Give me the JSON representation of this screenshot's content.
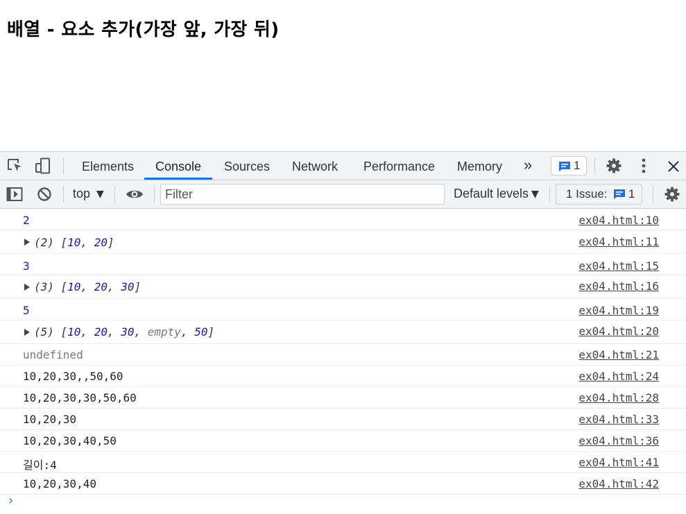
{
  "page": {
    "title": "배열 - 요소 추가(가장 앞, 가장 뒤)"
  },
  "devtools": {
    "tabs": [
      {
        "label": "Elements"
      },
      {
        "label": "Console"
      },
      {
        "label": "Sources"
      },
      {
        "label": "Network"
      },
      {
        "label": "Performance"
      },
      {
        "label": "Memory"
      }
    ],
    "more_tabs": "»",
    "messages_badge": "1",
    "toolbar": {
      "context": "top",
      "filter_placeholder": "Filter",
      "levels": "Default levels",
      "issues_label": "1 Issue:",
      "issues_count": "1"
    },
    "console": {
      "rows": [
        {
          "text": "2",
          "src": "ex04.html:10"
        },
        {
          "prefix": "(2) ",
          "open": "[",
          "items": [
            "10",
            "20"
          ],
          "close": "]",
          "src": "ex04.html:11"
        },
        {
          "text": "3",
          "src": "ex04.html:15"
        },
        {
          "prefix": "(3) ",
          "open": "[",
          "items": [
            "10",
            "20",
            "30"
          ],
          "close": "]",
          "src": "ex04.html:16"
        },
        {
          "text": "5",
          "src": "ex04.html:19"
        },
        {
          "prefix": "(5) ",
          "open": "[",
          "items": [
            "10",
            "20",
            "30",
            "empty",
            "50"
          ],
          "close": "]",
          "src": "ex04.html:20"
        },
        {
          "text": "undefined",
          "src": "ex04.html:21"
        },
        {
          "text": "10,20,30,,50,60",
          "src": "ex04.html:24"
        },
        {
          "text": "10,20,30,30,50,60",
          "src": "ex04.html:28"
        },
        {
          "text": "10,20,30",
          "src": "ex04.html:33"
        },
        {
          "text": "10,20,30,40,50",
          "src": "ex04.html:36"
        },
        {
          "text": "길이:4",
          "src": "ex04.html:41"
        },
        {
          "text": "10,20,30,40",
          "src": "ex04.html:42"
        }
      ],
      "prompt": "›"
    }
  },
  "colors": {
    "accent": "#1a73e8",
    "number": "#1a1aa6"
  }
}
